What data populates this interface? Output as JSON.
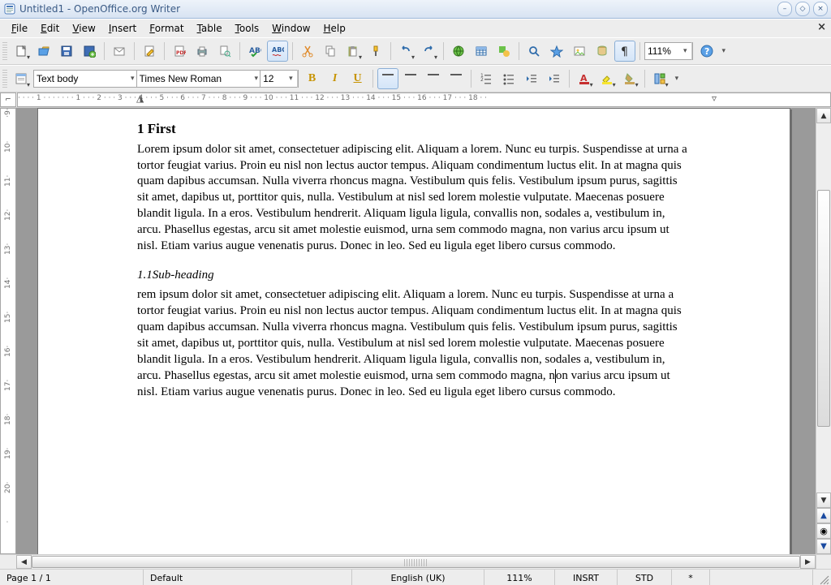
{
  "window": {
    "title": "Untitled1 - OpenOffice.org Writer"
  },
  "menu": {
    "file": "File",
    "edit": "Edit",
    "view": "View",
    "insert": "Insert",
    "format": "Format",
    "table": "Table",
    "tools": "Tools",
    "window": "Window",
    "help": "Help"
  },
  "toolbar1": {
    "zoom_value": "111%"
  },
  "toolbar2": {
    "style": "Text body",
    "font": "Times New Roman",
    "size": "12"
  },
  "ruler": {
    "horizontal": "· · · · 1 · · · ·     · · · 1 · · · 2 · · · 3 · · · 4 · · · 5 · · · 6 · · · 7 · · · 8 · · · 9 · · · 10 · · · 11 · · · 12 · · · 13 · · · 14 · · · 15 · · · 16 · · · 17   · · · 18 · ·",
    "vertical": [
      "·9·",
      "10·",
      "11·",
      "12·",
      "13·",
      "14·",
      "15·",
      "16·",
      "17·",
      "18·",
      "19·",
      "20·",
      "·"
    ]
  },
  "document": {
    "heading": "1  First",
    "para1": "Lorem ipsum dolor sit amet, consectetuer adipiscing elit. Aliquam a lorem. Nunc eu turpis. Suspendisse at urna a tortor feugiat varius. Proin eu nisl non lectus auctor tempus. Aliquam condimentum luctus elit. In at magna quis quam dapibus accumsan. Nulla viverra rhoncus magna. Vestibulum quis felis. Vestibulum ipsum purus, sagittis sit amet, dapibus ut, porttitor quis, nulla. Vestibulum at nisl sed lorem molestie vulputate. Maecenas posuere blandit ligula. In a eros. Vestibulum hendrerit. Aliquam ligula ligula, convallis non, sodales a, vestibulum in, arcu. Phasellus egestas, arcu sit amet molestie euismod, urna sem commodo magna, non varius arcu ipsum ut nisl. Etiam varius augue venenatis purus. Donec in leo. Sed eu ligula eget libero cursus commodo.",
    "subheading": "1.1Sub-heading",
    "para2_a": "rem ipsum dolor sit amet, consectetuer adipiscing elit. Aliquam a lorem. Nunc eu turpis. Suspendisse at urna a tortor feugiat varius. Proin eu nisl non lectus auctor tempus. Aliquam condimentum luctus elit. In at magna quis quam dapibus accumsan. Nulla viverra rhoncus magna. Vestibulum quis felis. Vestibulum ipsum purus, sagittis sit amet, dapibus ut, porttitor quis, nulla. Vestibulum at nisl sed lorem molestie vulputate. Maecenas posuere blandit ligula. In a eros. Vestibulum hendrerit. Aliquam ligula ligula, convallis non, sodales a, vestibulum in, arcu. Phasellus egestas, arcu sit amet molestie euismod, urna sem commodo magna, n",
    "para2_b": "n varius arcu ipsum ut nisl. Etiam varius augue venenatis purus. Donec in leo. Sed eu ligula eget libero cursus commodo."
  },
  "status": {
    "page": "Page 1 / 1",
    "style": "Default",
    "lang": "English (UK)",
    "zoom": "111%",
    "insert": "INSRT",
    "sel": "STD",
    "mod": "*"
  }
}
